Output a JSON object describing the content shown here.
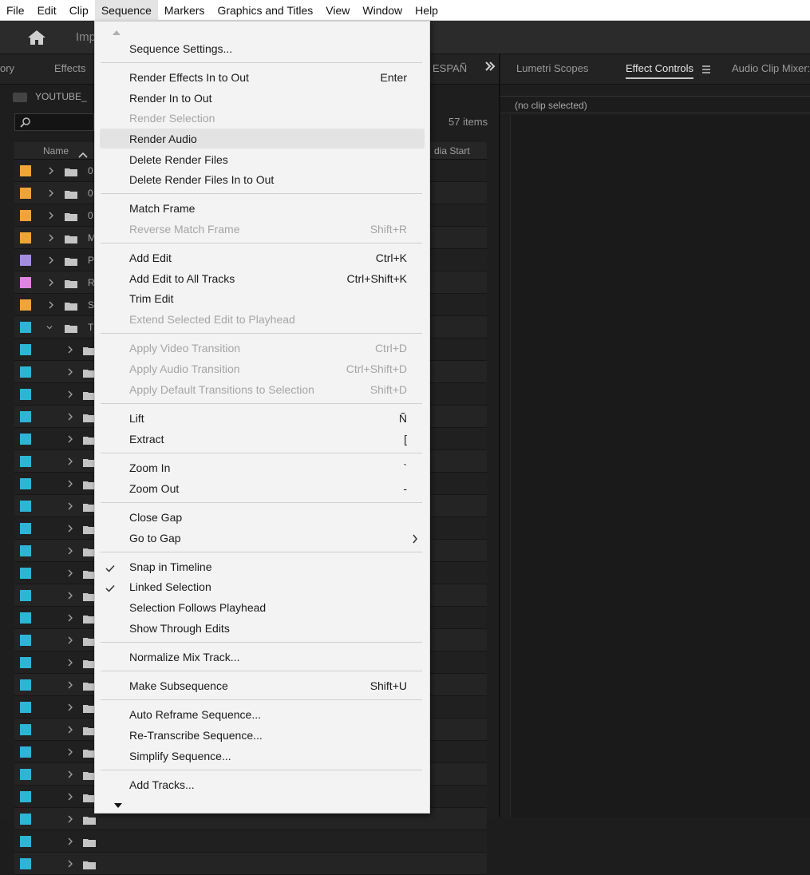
{
  "menubar": {
    "file": "File",
    "edit": "Edit",
    "clip": "Clip",
    "sequence": "Sequence",
    "markers": "Markers",
    "graphics_titles": "Graphics and Titles",
    "view": "View",
    "window": "Window",
    "help": "Help"
  },
  "topbar": {
    "import_partial": "Imp"
  },
  "left_panel": {
    "tabs": {
      "history_partial": "ory",
      "effects": "Effects",
      "espanol_partial": "ESPAÑ"
    },
    "project_name": "YOUTUBE_",
    "item_count": "57 items",
    "col_name": "Name",
    "col_media_start": "dia Start",
    "row_labels": [
      "0",
      "0",
      "0",
      "M",
      "P",
      "R",
      "S",
      "T"
    ]
  },
  "right_panel": {
    "tabs": {
      "lumetri": "Lumetri Scopes",
      "effect_controls": "Effect Controls",
      "audio_mixer": "Audio Clip Mixer:"
    },
    "no_clip": "(no clip selected)"
  },
  "menu": {
    "sequence_settings": "Sequence Settings...",
    "render_effects": "Render Effects In to Out",
    "render_effects_sc": "Enter",
    "render_in_out": "Render In to Out",
    "render_selection": "Render Selection",
    "render_audio": "Render Audio",
    "delete_render": "Delete Render Files",
    "delete_render_io": "Delete Render Files In to Out",
    "match_frame": "Match Frame",
    "reverse_match": "Reverse Match Frame",
    "reverse_match_sc": "Shift+R",
    "add_edit": "Add Edit",
    "add_edit_sc": "Ctrl+K",
    "add_edit_all": "Add Edit to All Tracks",
    "add_edit_all_sc": "Ctrl+Shift+K",
    "trim_edit": "Trim Edit",
    "extend_edit": "Extend Selected Edit to Playhead",
    "apply_video": "Apply Video Transition",
    "apply_video_sc": "Ctrl+D",
    "apply_audio": "Apply Audio Transition",
    "apply_audio_sc": "Ctrl+Shift+D",
    "apply_default": "Apply Default Transitions to Selection",
    "apply_default_sc": "Shift+D",
    "lift": "Lift",
    "lift_sc": "Ñ",
    "extract": "Extract",
    "extract_sc": "[",
    "zoom_in": "Zoom In",
    "zoom_in_sc": "`",
    "zoom_out": "Zoom Out",
    "zoom_out_sc": "-",
    "close_gap": "Close Gap",
    "go_to_gap": "Go to Gap",
    "snap": "Snap in Timeline",
    "linked": "Linked Selection",
    "sel_follows": "Selection Follows Playhead",
    "show_through": "Show Through Edits",
    "normalize": "Normalize Mix Track...",
    "make_sub": "Make Subsequence",
    "make_sub_sc": "Shift+U",
    "auto_reframe": "Auto Reframe Sequence...",
    "retranscribe": "Re-Transcribe Sequence...",
    "simplify": "Simplify Sequence...",
    "add_tracks": "Add Tracks..."
  },
  "colors": {
    "orange": "#f0a438",
    "purple": "#a48de0",
    "pink": "#e084e0",
    "cyan": "#2db5d6"
  }
}
